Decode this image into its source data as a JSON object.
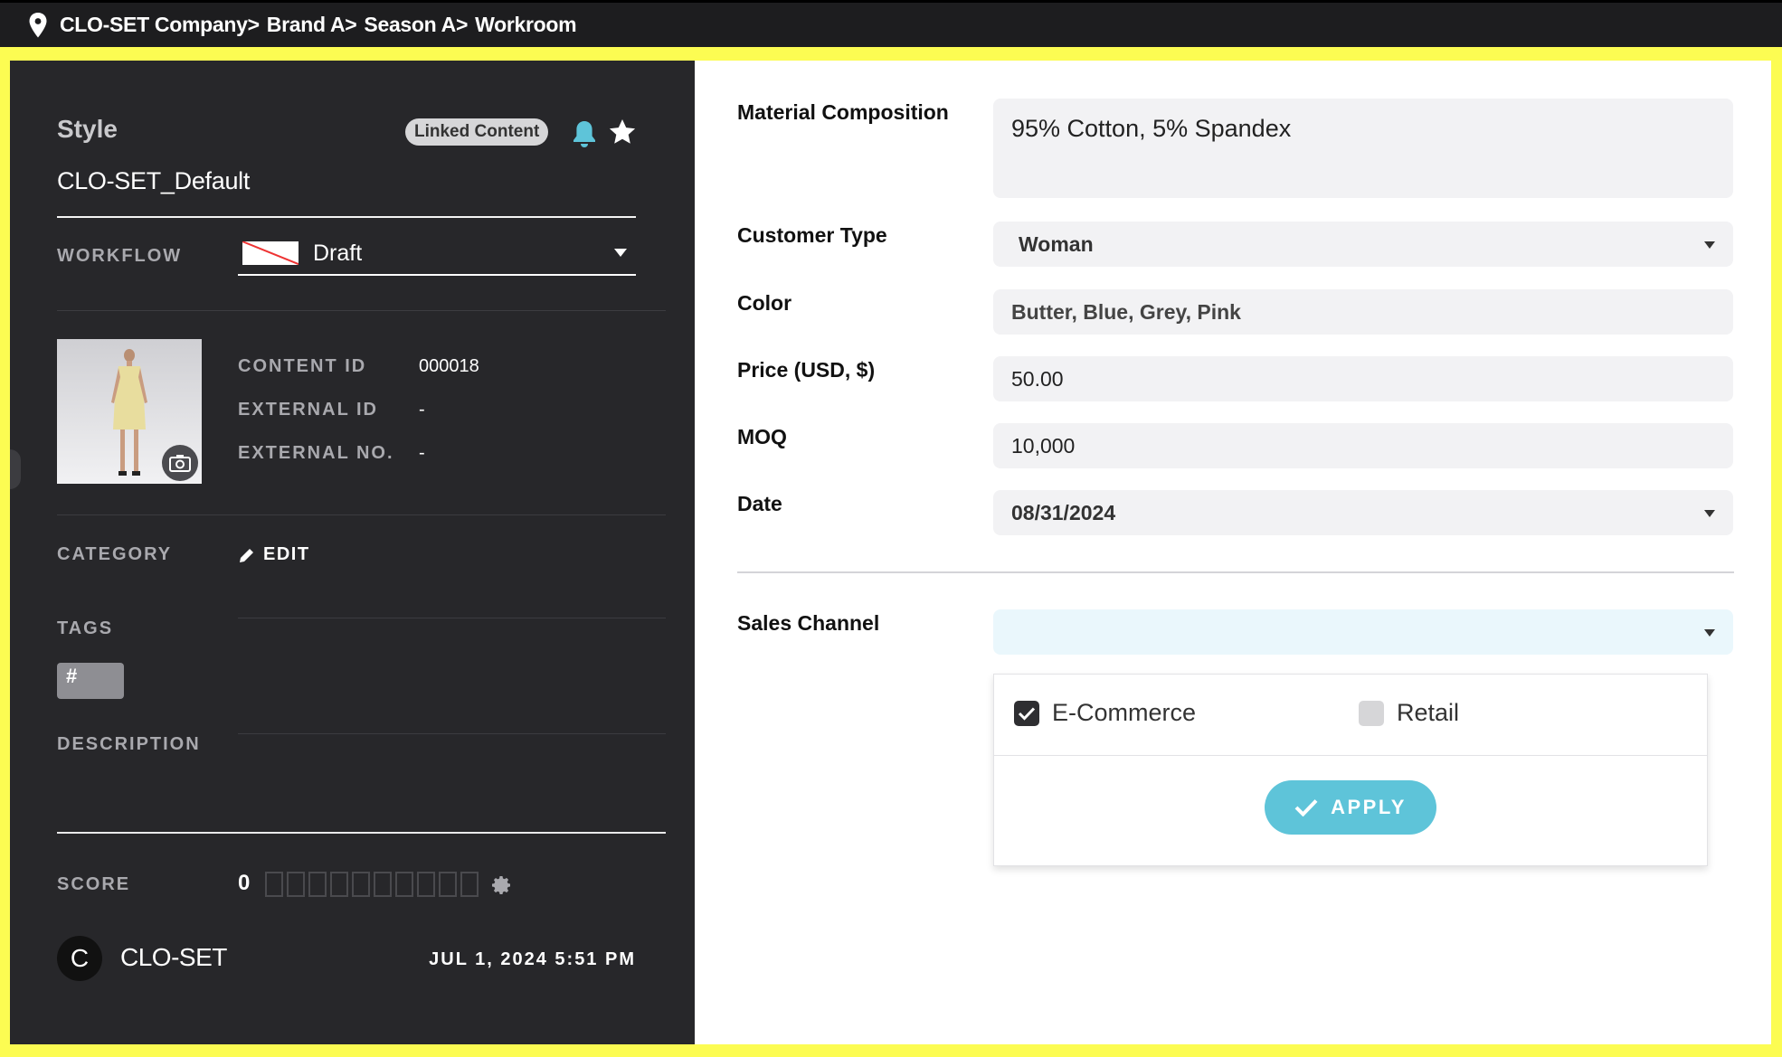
{
  "breadcrumb": [
    "CLO-SET Company",
    "Brand A",
    "Season A",
    "Workroom"
  ],
  "breadcrumb_separator": ">",
  "left_panel": {
    "section_title": "Style",
    "linked_badge": "Linked Content",
    "style_name": "CLO-SET_Default",
    "workflow": {
      "label": "WORKFLOW",
      "value": "Draft"
    },
    "meta": [
      {
        "key": "CONTENT ID",
        "value": "000018"
      },
      {
        "key": "EXTERNAL ID",
        "value": "-"
      },
      {
        "key": "EXTERNAL NO.",
        "value": "-"
      }
    ],
    "category": {
      "label": "CATEGORY",
      "edit_label": "EDIT"
    },
    "tags": {
      "label": "TAGS",
      "chip": "#"
    },
    "description": {
      "label": "DESCRIPTION"
    },
    "score": {
      "label": "SCORE",
      "value": "0",
      "max_boxes": 10
    },
    "owner": {
      "initial": "C",
      "name": "CLO-SET"
    },
    "datetime": "JUL 1, 2024 5:51 PM"
  },
  "fields": {
    "material": {
      "label": "Material Composition",
      "value": "95% Cotton, 5% Spandex"
    },
    "customer_type": {
      "label": "Customer Type",
      "value": "Woman"
    },
    "color": {
      "label": "Color",
      "value": "Butter, Blue, Grey, Pink"
    },
    "price": {
      "label": "Price (USD, $)",
      "value": "50.00"
    },
    "moq": {
      "label": "MOQ",
      "value": "10,000"
    },
    "date": {
      "label": "Date",
      "value": "08/31/2024"
    },
    "sales_channel": {
      "label": "Sales Channel",
      "value": ""
    }
  },
  "sales_dropdown": {
    "options": [
      {
        "label": "E-Commerce",
        "checked": true
      },
      {
        "label": "Retail",
        "checked": false
      }
    ],
    "apply_label": "APPLY"
  },
  "colors": {
    "frame": "#fcfc52",
    "panel_dark": "#27272a",
    "accent": "#5ec4d9",
    "sales_field_bg": "#eaf7fc"
  }
}
